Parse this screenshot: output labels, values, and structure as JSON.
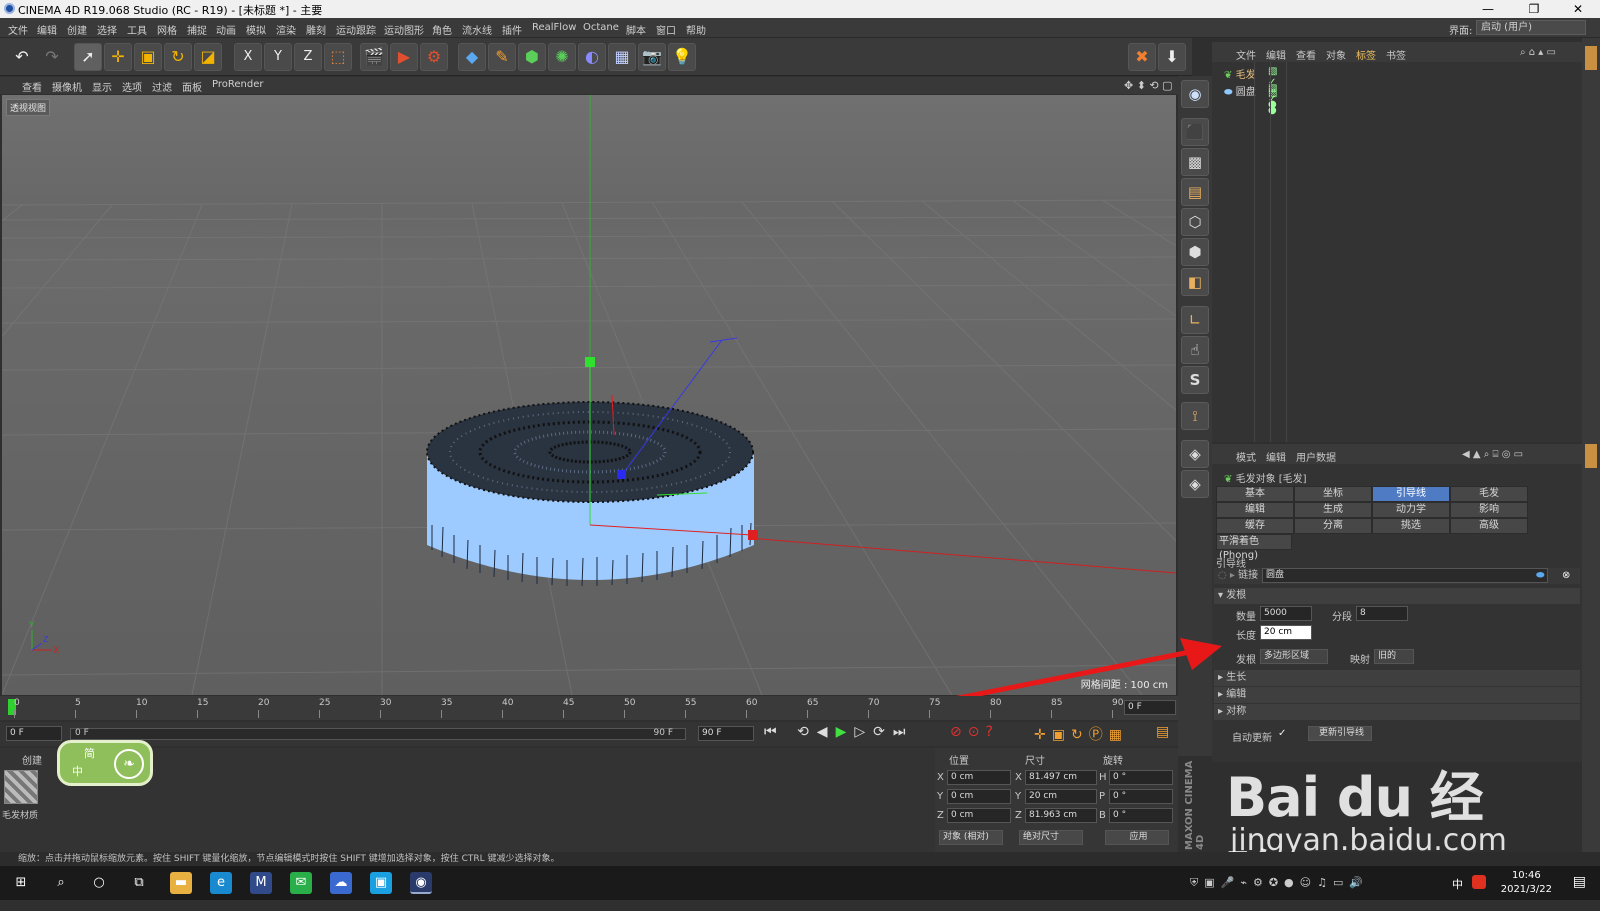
{
  "window": {
    "title": "CINEMA 4D R19.068 Studio (RC - R19) - [未标题 *] - 主要",
    "minimize": "—",
    "maximize": "❐",
    "close": "✕"
  },
  "menubar": {
    "items": [
      "文件",
      "编辑",
      "创建",
      "选择",
      "工具",
      "网格",
      "捕捉",
      "动画",
      "模拟",
      "渲染",
      "雕刻",
      "运动跟踪",
      "运动图形",
      "角色",
      "流水线",
      "插件",
      "RealFlow",
      "Octane",
      "脚本",
      "窗口",
      "帮助"
    ],
    "layout_label": "界面:",
    "layout_value": "启动 (用户)"
  },
  "toolbar": {
    "axis_x": "X",
    "axis_y": "Y",
    "axis_z": "Z"
  },
  "viewport_menu": {
    "items": [
      "查看",
      "摄像机",
      "显示",
      "选项",
      "过滤",
      "面板",
      "ProRender"
    ]
  },
  "viewport": {
    "label": "透视视图",
    "grid_info": "网格间距 : 100 cm",
    "axis_y": "Y",
    "axis_x": "X",
    "axis_z": "Z"
  },
  "object_manager": {
    "menu": [
      "文件",
      "编辑",
      "查看",
      "对象",
      "标签",
      "书签"
    ],
    "objects": [
      {
        "name": "毛发"
      },
      {
        "name": "圆盘"
      }
    ]
  },
  "attribute_manager": {
    "menu": [
      "模式",
      "编辑",
      "用户数据"
    ],
    "object_title": "毛发对象 [毛发]",
    "tabs": [
      {
        "label": "基本",
        "selected": false
      },
      {
        "label": "坐标",
        "selected": false
      },
      {
        "label": "引导线",
        "selected": true
      },
      {
        "label": "毛发",
        "selected": false
      },
      {
        "label": "编辑",
        "selected": false
      },
      {
        "label": "生成",
        "selected": false
      },
      {
        "label": "动力学",
        "selected": false
      },
      {
        "label": "影响",
        "selected": false
      },
      {
        "label": "缓存",
        "selected": false
      },
      {
        "label": "分离",
        "selected": false
      },
      {
        "label": "挑选",
        "selected": false
      },
      {
        "label": "高级",
        "selected": false
      }
    ],
    "phong": "平滑着色(Phong)",
    "section_title": "引导线",
    "link_label": "链接",
    "link_value": "圆盘",
    "hair_root_header": "发根",
    "count_label": "数量",
    "count_value": "5000",
    "segments_label": "分段",
    "segments_value": "8",
    "length_label": "长度",
    "length_value": "20 cm",
    "root_label": "发根",
    "root_value": "多边形区域",
    "map_label": "映射",
    "map_value": "旧的",
    "collapsed_sections": [
      "生长",
      "编辑",
      "对称"
    ],
    "auto_update_label": "自动更新",
    "update_button": "更新引导线"
  },
  "timeline": {
    "ticks": [
      "0",
      "5",
      "10",
      "15",
      "20",
      "25",
      "30",
      "35",
      "40",
      "45",
      "50",
      "55",
      "60",
      "65",
      "70",
      "75",
      "80",
      "85",
      "90"
    ],
    "current_frame": "0 F",
    "start": "0 F",
    "range_start": "0 F",
    "range_end": "90 F",
    "end": "90 F"
  },
  "material_manager": {
    "menu": [
      "创建"
    ],
    "material_name": "毛发材质"
  },
  "badge": {
    "line1": "简",
    "line2": "中"
  },
  "coordinates": {
    "headers": [
      "位置",
      "尺寸",
      "旋转"
    ],
    "rows": [
      {
        "axis": "X",
        "pos": "0 cm",
        "size_axis": "X",
        "size": "81.497 cm",
        "rot_axis": "H",
        "rot": "0 °"
      },
      {
        "axis": "Y",
        "pos": "0 cm",
        "size_axis": "Y",
        "size": "20 cm",
        "rot_axis": "P",
        "rot": "0 °"
      },
      {
        "axis": "Z",
        "pos": "0 cm",
        "size_axis": "Z",
        "size": "81.963 cm",
        "rot_axis": "B",
        "rot": "0 °"
      }
    ],
    "mode": "对象 (相对)",
    "size_mode": "绝对尺寸",
    "apply": "应用"
  },
  "brand": "MAXON CINEMA 4D",
  "status": "缩放：点击并拖动鼠标缩放元素。按住 SHIFT 键量化缩放，节点编辑模式时按住 SHIFT 键增加选择对象，按住 CTRL 键减少选择对象。",
  "taskbar": {
    "time": "10:46",
    "date": "2021/3/22",
    "ime": "中"
  },
  "watermark": {
    "brand": "Bai du 经验",
    "url": "jingyan.baidu.com"
  },
  "colors": {
    "accent": "#4f7bc4",
    "hair": "#9ecbff",
    "annotation_arrow": "#e81818"
  }
}
